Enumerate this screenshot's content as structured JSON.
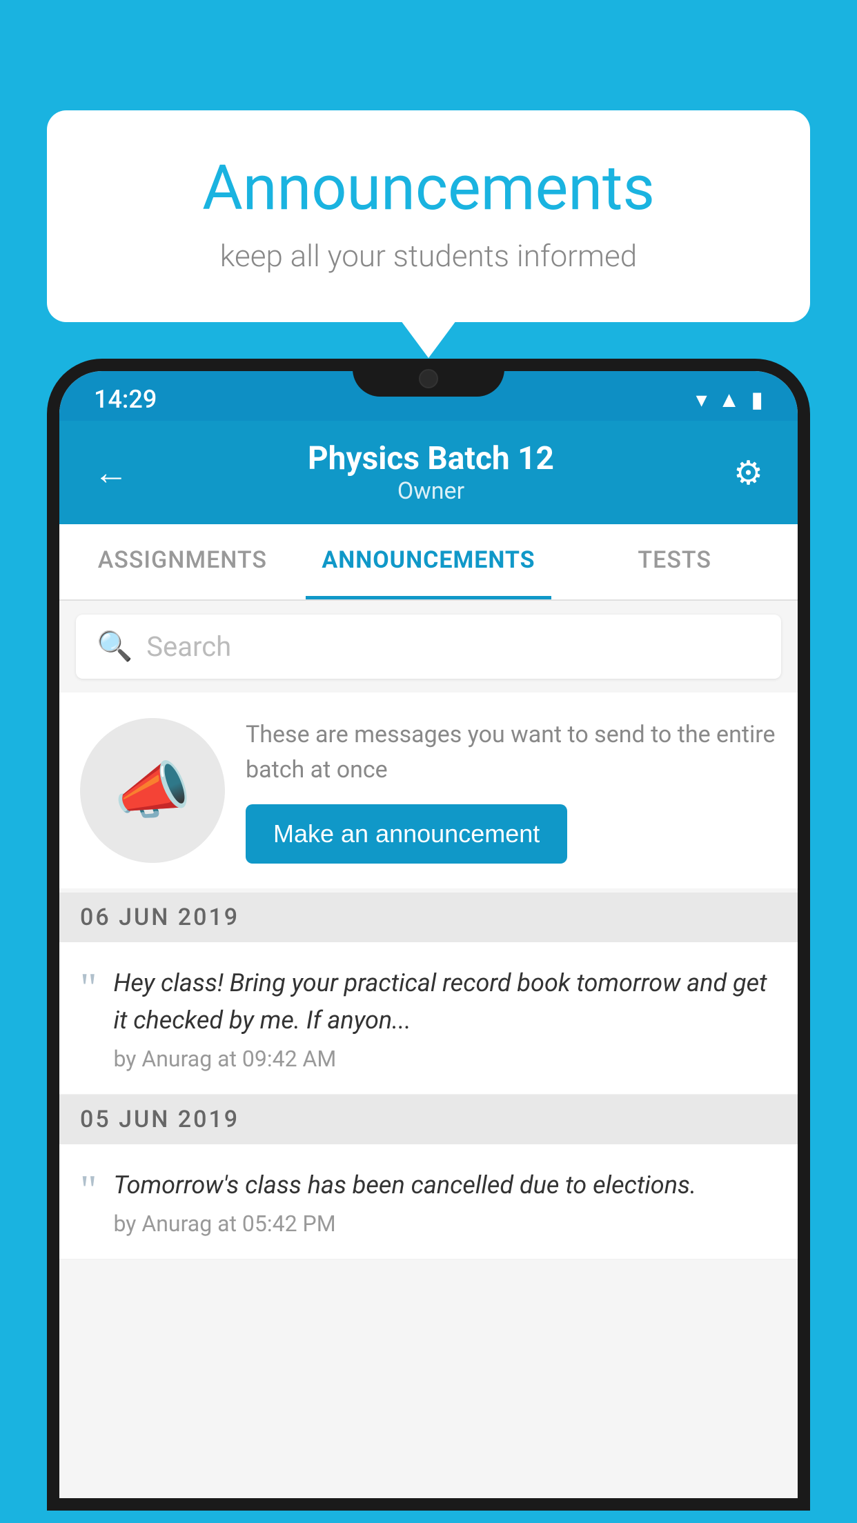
{
  "background": {
    "color": "#1ab3e0"
  },
  "speech_bubble": {
    "title": "Announcements",
    "subtitle": "keep all your students informed"
  },
  "status_bar": {
    "time": "14:29",
    "icons": [
      "wifi",
      "signal",
      "battery"
    ]
  },
  "app_header": {
    "back_label": "←",
    "title": "Physics Batch 12",
    "subtitle": "Owner",
    "settings_label": "⚙"
  },
  "tabs": [
    {
      "label": "ASSIGNMENTS",
      "active": false
    },
    {
      "label": "ANNOUNCEMENTS",
      "active": true
    },
    {
      "label": "TESTS",
      "active": false
    }
  ],
  "search": {
    "placeholder": "Search"
  },
  "promo": {
    "description": "These are messages you want to send to the entire batch at once",
    "button_label": "Make an announcement"
  },
  "date_groups": [
    {
      "date": "06  JUN  2019",
      "items": [
        {
          "text": "Hey class! Bring your practical record book tomorrow and get it checked by me. If anyon...",
          "meta": "by Anurag at 09:42 AM"
        }
      ]
    },
    {
      "date": "05  JUN  2019",
      "items": [
        {
          "text": "Tomorrow's class has been cancelled due to elections.",
          "meta": "by Anurag at 05:42 PM"
        }
      ]
    }
  ]
}
